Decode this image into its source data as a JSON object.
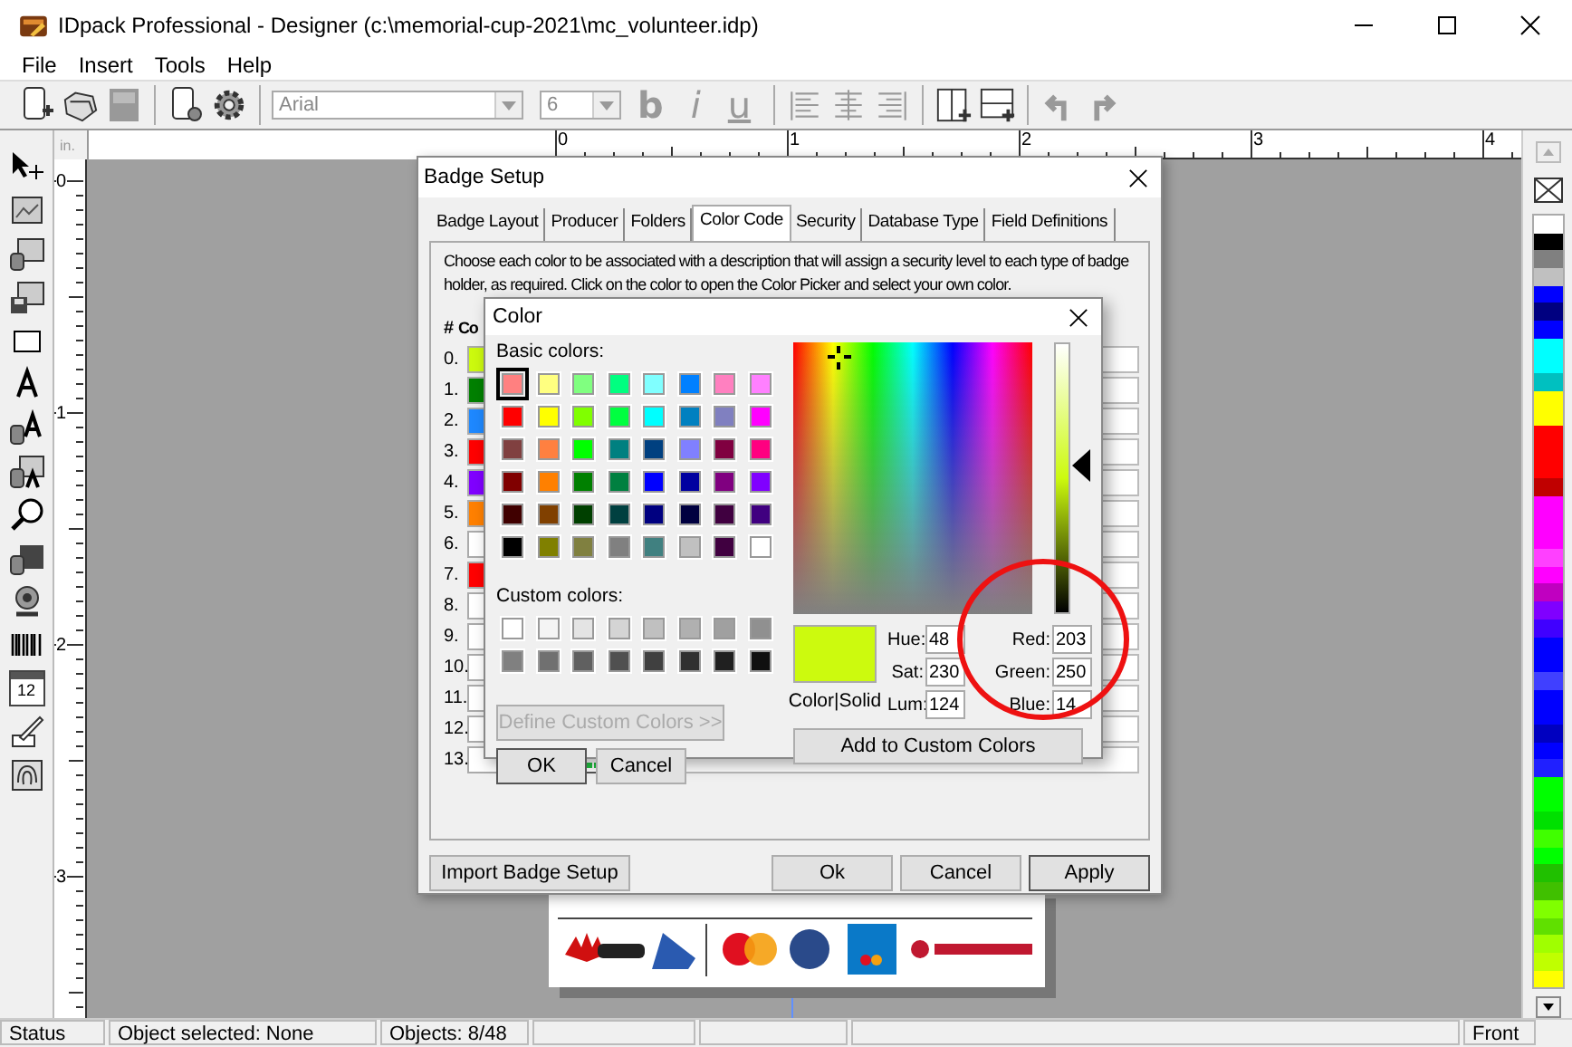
{
  "window": {
    "title": "IDpack Professional - Designer (c:\\memorial-cup-2021\\mc_volunteer.idp)"
  },
  "menu": [
    "File",
    "Insert",
    "Tools",
    "Help"
  ],
  "toolbar": {
    "font": "Arial",
    "size": "6",
    "format_buttons": [
      {
        "label": "b",
        "disabled": true
      },
      {
        "label": "i",
        "disabled": true
      },
      {
        "label": "u",
        "disabled": true
      }
    ]
  },
  "tools": {
    "calendar_day": "12"
  },
  "ruler": {
    "unit": "in.",
    "marks": [
      "0",
      "1",
      "2",
      "3",
      "4"
    ],
    "vertical_marks": [
      "0",
      "1",
      "2",
      "3"
    ]
  },
  "palette": [
    {
      "color": "#ffffff"
    },
    {
      "color": "#000000"
    },
    {
      "color": "#808080"
    },
    {
      "color": "#c0c0c0"
    },
    {
      "color": "#0000ff"
    },
    {
      "color": "#000080"
    },
    {
      "color": "#0000ff"
    },
    {
      "color": "#00ffff"
    },
    {
      "color": "#00ffff"
    },
    {
      "color": "#00c0c0"
    },
    {
      "color": "#ffff00"
    },
    {
      "color": "#ffff00"
    },
    {
      "color": "#ff0000"
    },
    {
      "color": "#ff0000"
    },
    {
      "color": "#ff0000"
    },
    {
      "color": "#c00000"
    },
    {
      "color": "#ff00ff"
    },
    {
      "color": "#ff00ff"
    },
    {
      "color": "#ff00ff"
    },
    {
      "color": "#ff40ff"
    },
    {
      "color": "#ff00ff"
    },
    {
      "color": "#c000c0"
    },
    {
      "color": "#8000ff"
    },
    {
      "color": "#4000ff"
    },
    {
      "color": "#0000ff"
    },
    {
      "color": "#0000ff"
    },
    {
      "color": "#4040ff"
    },
    {
      "color": "#0000ff"
    },
    {
      "color": "#0000ff"
    },
    {
      "color": "#0000c0"
    },
    {
      "color": "#0000ff"
    },
    {
      "color": "#2020ff"
    },
    {
      "color": "#00ff00"
    },
    {
      "color": "#00ff00"
    },
    {
      "color": "#00e000"
    },
    {
      "color": "#40ff00"
    },
    {
      "color": "#00ff00"
    },
    {
      "color": "#20c000"
    },
    {
      "color": "#40c000"
    },
    {
      "color": "#80ff00"
    },
    {
      "color": "#60e000"
    },
    {
      "color": "#a0ff00"
    },
    {
      "color": "#c0ff00"
    },
    {
      "color": "#ffff00"
    }
  ],
  "badge_setup": {
    "title": "Badge Setup",
    "tabs": [
      {
        "label": "Badge Layout",
        "selected": false
      },
      {
        "label": "Producer",
        "selected": false
      },
      {
        "label": "Folders",
        "selected": false
      },
      {
        "label": "Color Code",
        "selected": true
      },
      {
        "label": "Security",
        "selected": false
      },
      {
        "label": "Database Type",
        "selected": false
      },
      {
        "label": "Field Definitions",
        "selected": false
      }
    ],
    "description": "Choose each color to be associated with a description that will assign a security level to each type of badge holder, as required. Click on the color to open the Color Picker and select your own color.",
    "columns": [
      "#",
      "Co"
    ],
    "rows": [
      {
        "index": "0.",
        "color": "#ccfa0e",
        "picker": false
      },
      {
        "index": "1.",
        "color": "#008000",
        "picker": false
      },
      {
        "index": "2.",
        "color": "#1e88ff",
        "picker": false
      },
      {
        "index": "3.",
        "color": "#ff0000",
        "picker": false
      },
      {
        "index": "4.",
        "color": "#8000ff",
        "picker": false
      },
      {
        "index": "5.",
        "color": "#ff8000",
        "picker": false
      },
      {
        "index": "6.",
        "color": "#ffffff",
        "picker": false
      },
      {
        "index": "7.",
        "color": "#ff0000",
        "picker": false
      },
      {
        "index": "8.",
        "color": "#ffffff",
        "picker": false
      },
      {
        "index": "9.",
        "color": "#ffffff",
        "picker": false
      },
      {
        "index": "10.",
        "color": "#ffffff",
        "picker": false
      },
      {
        "index": "11.",
        "color": "#ffffff",
        "picker": false
      },
      {
        "index": "12.",
        "color": "#ffffff",
        "picker": false
      },
      {
        "index": "13.",
        "color": "#ffffff",
        "picker": true
      }
    ],
    "buttons": [
      "Import Badge Setup",
      "Ok",
      "Cancel",
      "Apply"
    ]
  },
  "color_dialog": {
    "title": "Color",
    "basic_label": "Basic colors:",
    "basic_colors": [
      {
        "color": "#ff8080",
        "selected": true
      },
      {
        "color": "#ffff80",
        "selected": false
      },
      {
        "color": "#80ff80",
        "selected": false
      },
      {
        "color": "#00ff80",
        "selected": false
      },
      {
        "color": "#80ffff",
        "selected": false
      },
      {
        "color": "#0080ff",
        "selected": false
      },
      {
        "color": "#ff80c0",
        "selected": false
      },
      {
        "color": "#ff80ff",
        "selected": false
      },
      {
        "color": "#ff0000",
        "selected": false
      },
      {
        "color": "#ffff00",
        "selected": false
      },
      {
        "color": "#80ff00",
        "selected": false
      },
      {
        "color": "#00ff40",
        "selected": false
      },
      {
        "color": "#00ffff",
        "selected": false
      },
      {
        "color": "#0080c0",
        "selected": false
      },
      {
        "color": "#8080c0",
        "selected": false
      },
      {
        "color": "#ff00ff",
        "selected": false
      },
      {
        "color": "#804040",
        "selected": false
      },
      {
        "color": "#ff8040",
        "selected": false
      },
      {
        "color": "#00ff00",
        "selected": false
      },
      {
        "color": "#008080",
        "selected": false
      },
      {
        "color": "#004080",
        "selected": false
      },
      {
        "color": "#8080ff",
        "selected": false
      },
      {
        "color": "#800040",
        "selected": false
      },
      {
        "color": "#ff0080",
        "selected": false
      },
      {
        "color": "#800000",
        "selected": false
      },
      {
        "color": "#ff8000",
        "selected": false
      },
      {
        "color": "#008000",
        "selected": false
      },
      {
        "color": "#008040",
        "selected": false
      },
      {
        "color": "#0000ff",
        "selected": false
      },
      {
        "color": "#0000a0",
        "selected": false
      },
      {
        "color": "#800080",
        "selected": false
      },
      {
        "color": "#8000ff",
        "selected": false
      },
      {
        "color": "#400000",
        "selected": false
      },
      {
        "color": "#804000",
        "selected": false
      },
      {
        "color": "#004000",
        "selected": false
      },
      {
        "color": "#004040",
        "selected": false
      },
      {
        "color": "#000080",
        "selected": false
      },
      {
        "color": "#000040",
        "selected": false
      },
      {
        "color": "#400040",
        "selected": false
      },
      {
        "color": "#400080",
        "selected": false
      },
      {
        "color": "#000000",
        "selected": false
      },
      {
        "color": "#808000",
        "selected": false
      },
      {
        "color": "#808040",
        "selected": false
      },
      {
        "color": "#808080",
        "selected": false
      },
      {
        "color": "#408080",
        "selected": false
      },
      {
        "color": "#c0c0c0",
        "selected": false
      },
      {
        "color": "#400040",
        "selected": false
      },
      {
        "color": "#ffffff",
        "selected": false
      }
    ],
    "custom_label": "Custom colors:",
    "custom_colors": [
      {
        "color": "#ffffff"
      },
      {
        "color": "#f4f4f4"
      },
      {
        "color": "#e4e4e4"
      },
      {
        "color": "#d4d4d4"
      },
      {
        "color": "#c0c0c0"
      },
      {
        "color": "#b0b0b0"
      },
      {
        "color": "#a0a0a0"
      },
      {
        "color": "#909090"
      },
      {
        "color": "#808080"
      },
      {
        "color": "#707070"
      },
      {
        "color": "#606060"
      },
      {
        "color": "#505050"
      },
      {
        "color": "#404040"
      },
      {
        "color": "#303030"
      },
      {
        "color": "#202020"
      },
      {
        "color": "#101010"
      }
    ],
    "define_button": {
      "label": "Define Custom Colors >>",
      "disabled": true
    },
    "ok": "OK",
    "cancel": "Cancel",
    "preview_label": "Color|Solid",
    "hsl_fields": [
      {
        "label": "Hue:",
        "value": "48"
      },
      {
        "label": "Sat:",
        "value": "230"
      },
      {
        "label": "Lum:",
        "value": "124"
      }
    ],
    "rgb_fields": [
      {
        "label": "Red:",
        "value": "203"
      },
      {
        "label": "Green:",
        "value": "250"
      },
      {
        "label": "Blue:",
        "value": "14"
      }
    ],
    "luminance_slider": {
      "level": 0.55
    },
    "add_button": "Add to Custom Colors",
    "highlight": {
      "kind": "circle",
      "color": "#ee1111"
    }
  },
  "status_bar": {
    "status": "Status",
    "selection": "Object selected: None",
    "objects": "Objects: 8/48",
    "side": "Front"
  }
}
